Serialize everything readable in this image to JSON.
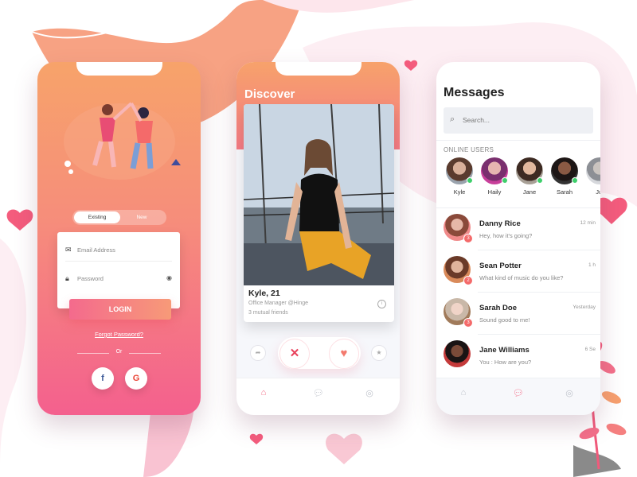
{
  "colors": {
    "accent_pink": "#f4608e",
    "accent_orange": "#f7a36a",
    "online_green": "#3ecf6b",
    "badge_red": "#f46a6a"
  },
  "login": {
    "toggle_existing": "Existing",
    "toggle_new": "New",
    "email_placeholder": "Email Address",
    "password_placeholder": "Password",
    "login_button": "LOGIN",
    "forgot": "Forgot Password?",
    "or": "Or",
    "facebook_glyph": "f",
    "google_glyph": "G"
  },
  "discover": {
    "title": "Discover",
    "profile_name": "Kyle, 21",
    "profile_job": "Office Manager @Hinge",
    "profile_mutual": "3 mutual friends",
    "icons": {
      "share": "share-icon",
      "reject": "close-icon",
      "like": "heart-icon",
      "star": "star-icon",
      "home_tab": "home-icon",
      "chat_tab": "chat-icon",
      "profile_tab": "user-icon"
    }
  },
  "messages": {
    "title": "Messages",
    "search_placeholder": "Search...",
    "online_label": "ONLINE USERS",
    "online_users": [
      {
        "name": "Kyle"
      },
      {
        "name": "Haily"
      },
      {
        "name": "Jane"
      },
      {
        "name": "Sarah"
      },
      {
        "name": "Jul"
      }
    ],
    "conversations": [
      {
        "name": "Danny Rice",
        "message": "Hey, how it's going?",
        "time": "12 min",
        "badge": "3"
      },
      {
        "name": "Sean Potter",
        "message": "What kind of music do you like?",
        "time": "1 h",
        "badge": "2"
      },
      {
        "name": "Sarah Doe",
        "message": "Sound good to me!",
        "time": "Yesterday",
        "badge": "3"
      },
      {
        "name": "Jane Williams",
        "message": "You : How are you?",
        "time": "6 Se"
      }
    ]
  }
}
